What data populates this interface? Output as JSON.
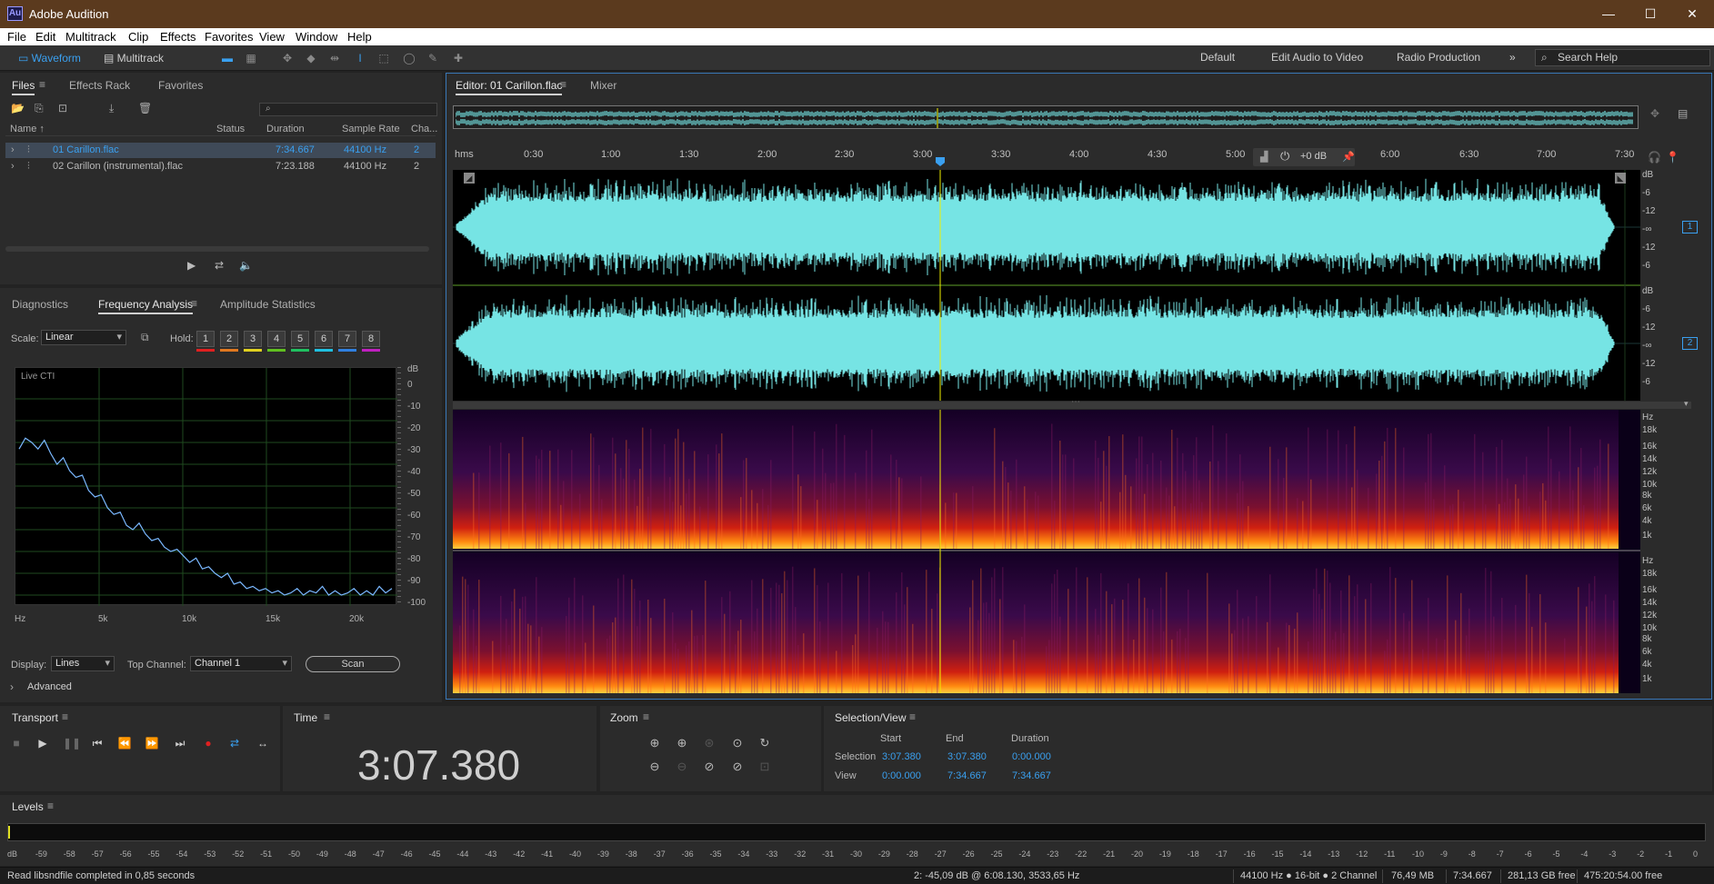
{
  "window": {
    "title": "Adobe Audition",
    "logo": "Au"
  },
  "menu": [
    "File",
    "Edit",
    "Multitrack",
    "Clip",
    "Effects",
    "Favorites",
    "View",
    "Window",
    "Help"
  ],
  "toolbar": {
    "waveform_label": "Waveform",
    "multitrack_label": "Multitrack",
    "workspaces": [
      "Default",
      "Edit Audio to Video",
      "Radio Production"
    ],
    "more": "»",
    "search_placeholder": "Search Help"
  },
  "files_panel": {
    "tabs": [
      "Files",
      "Effects Rack",
      "Favorites"
    ],
    "columns": [
      "Name ↑",
      "Status",
      "Duration",
      "Sample Rate",
      "Cha..."
    ],
    "rows": [
      {
        "name": "01 Carillon.flac",
        "status": "",
        "duration": "7:34.667",
        "rate": "44100 Hz",
        "channels": "2",
        "selected": true
      },
      {
        "name": "02 Carillon (instrumental).flac",
        "status": "",
        "duration": "7:23.188",
        "rate": "44100 Hz",
        "channels": "2",
        "selected": false
      }
    ]
  },
  "analysis_panel": {
    "tabs": [
      "Diagnostics",
      "Frequency Analysis",
      "Amplitude Statistics"
    ],
    "scale_label": "Scale:",
    "scale_value": "Linear",
    "hold_label": "Hold:",
    "hold_buttons": [
      "1",
      "2",
      "3",
      "4",
      "5",
      "6",
      "7",
      "8"
    ],
    "hold_colors": [
      "#e02020",
      "#e07820",
      "#e0d020",
      "#60c020",
      "#20c060",
      "#20c0e0",
      "#3080e0",
      "#c020c0"
    ],
    "graph_label": "Live CTI",
    "db_unit": "dB",
    "db_ticks": [
      "0",
      "-10",
      "-20",
      "-30",
      "-40",
      "-50",
      "-60",
      "-70",
      "-80",
      "-90",
      "-100"
    ],
    "hz_ticks": [
      "Hz",
      "5k",
      "10k",
      "15k",
      "20k"
    ],
    "display_label": "Display:",
    "display_value": "Lines",
    "top_channel_label": "Top Channel:",
    "top_channel_value": "Channel 1",
    "scan_label": "Scan",
    "advanced_label": "Advanced",
    "spectrum_db": [
      -33,
      -28,
      -30,
      -33,
      -29,
      -35,
      -40,
      -37,
      -43,
      -46,
      -45,
      -52,
      -55,
      -54,
      -60,
      -63,
      -62,
      -68,
      -70,
      -67,
      -72,
      -75,
      -74,
      -78,
      -80,
      -79,
      -82,
      -85,
      -83,
      -88,
      -87,
      -90,
      -92,
      -90,
      -95,
      -94,
      -97,
      -96,
      -98,
      -97,
      -99,
      -98,
      -100,
      -99,
      -97,
      -100,
      -98,
      -99,
      -96,
      -100,
      -98,
      -100,
      -99,
      -97,
      -100,
      -98,
      -100,
      -96,
      -99,
      -97
    ]
  },
  "editor": {
    "tab_label": "Editor: 01 Carillon.flac",
    "mixer_label": "Mixer",
    "ruler_labels": [
      "hms",
      "0:30",
      "1:00",
      "1:30",
      "2:00",
      "2:30",
      "3:00",
      "3:30",
      "4:00",
      "4:30",
      "5:00",
      "6:00",
      "6:30",
      "7:00",
      "7:30"
    ],
    "hud_gain": "+0 dB",
    "amp_scale": [
      "dB",
      "-6",
      "-12",
      "-∞",
      "-12",
      "-6"
    ],
    "channel_numbers": [
      "1",
      "2"
    ],
    "freq_scale": [
      "Hz",
      "18k",
      "16k",
      "14k",
      "12k",
      "10k",
      "8k",
      "6k",
      "4k",
      "1k"
    ],
    "playhead_time": "3:07.380"
  },
  "transport": {
    "title": "Transport"
  },
  "time_panel": {
    "title": "Time",
    "value": "3:07.380"
  },
  "zoom_panel": {
    "title": "Zoom"
  },
  "selection_panel": {
    "title": "Selection/View",
    "headers": [
      "Start",
      "End",
      "Duration"
    ],
    "selection_label": "Selection",
    "selection": [
      "3:07.380",
      "3:07.380",
      "0:00.000"
    ],
    "view_label": "View",
    "view": [
      "0:00.000",
      "7:34.667",
      "7:34.667"
    ]
  },
  "levels": {
    "title": "Levels",
    "ticks": [
      "dB",
      "-59",
      "-58",
      "-57",
      "-56",
      "-55",
      "-54",
      "-53",
      "-52",
      "-51",
      "-50",
      "-49",
      "-48",
      "-47",
      "-46",
      "-45",
      "-44",
      "-43",
      "-42",
      "-41",
      "-40",
      "-39",
      "-38",
      "-37",
      "-36",
      "-35",
      "-34",
      "-33",
      "-32",
      "-31",
      "-30",
      "-29",
      "-28",
      "-27",
      "-26",
      "-25",
      "-24",
      "-23",
      "-22",
      "-21",
      "-20",
      "-19",
      "-18",
      "-17",
      "-16",
      "-15",
      "-14",
      "-13",
      "-12",
      "-11",
      "-10",
      "-9",
      "-8",
      "-7",
      "-6",
      "-5",
      "-4",
      "-3",
      "-2",
      "-1",
      "0"
    ]
  },
  "status": {
    "message": "Read libsndfile completed in 0,85 seconds",
    "cursor_info": "2: -45,09 dB @ 6:08.130, 3533,65 Hz",
    "format": "44100 Hz ● 16-bit ● 2 Channel",
    "size": "76,49 MB",
    "duration": "7:34.667",
    "free": "281,13 GB free",
    "extra": "475:20:54.00 free"
  },
  "colors": {
    "waveform": "#76e4e4",
    "accent": "#3aa0f0",
    "playhead": "#f0f000",
    "titlebar": "#5b3a1e"
  }
}
